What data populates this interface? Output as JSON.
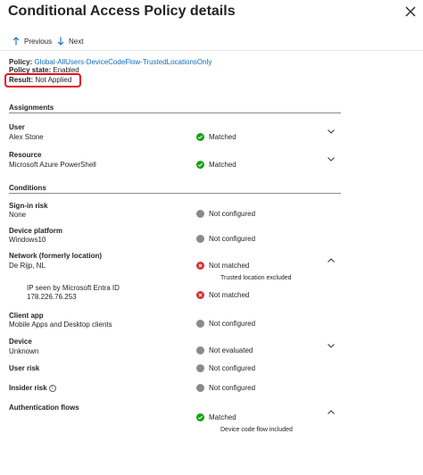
{
  "header": {
    "title": "Conditional Access Policy details",
    "close_icon": "close-icon"
  },
  "toolbar": {
    "previous_label": "Previous",
    "next_label": "Next"
  },
  "policy": {
    "policy_label": "Policy:",
    "policy_name": "Global-AllUsers-DeviceCodeFlow-TrustedLocationsOnly",
    "state_label": "Policy state:",
    "state_value": "Enabled",
    "result_label": "Result:",
    "result_value": "Not Applied"
  },
  "highlight_color": "#e8101e",
  "sections": {
    "assignments": "Assignments",
    "conditions": "Conditions"
  },
  "assignments": {
    "user": {
      "label": "User",
      "value": "Alex Stone",
      "status": "Matched"
    },
    "resource": {
      "label": "Resource",
      "value": "Microsoft Azure PowerShell",
      "status": "Matched"
    }
  },
  "conditions": {
    "sign_in_risk": {
      "label": "Sign-in risk",
      "value": "None",
      "status": "Not configured"
    },
    "device_platform": {
      "label": "Device platform",
      "value": "Windows10",
      "status": "Not configured"
    },
    "network": {
      "label": "Network (formerly location)",
      "value": "De Rijp, NL",
      "status": "Not matched",
      "note": "Trusted location excluded",
      "ip_seen_label": "IP seen by Microsoft Entra ID",
      "ip_value": "178.226.76.253",
      "ip_status": "Not matched"
    },
    "client_app": {
      "label": "Client app",
      "value": "Mobile Apps and Desktop clients",
      "status": "Not configured"
    },
    "device": {
      "label": "Device",
      "value": "Unknown",
      "status": "Not evaluated"
    },
    "user_risk": {
      "label": "User risk",
      "status": "Not configured"
    },
    "insider_risk": {
      "label": "Insider risk",
      "status": "Not configured"
    },
    "auth_flows": {
      "label": "Authentication flows",
      "status": "Matched",
      "note": "Device code flow included"
    }
  },
  "colors": {
    "matched": "#13a10e",
    "not_matched": "#d13438",
    "neutral": "#8a8a8a",
    "link": "#0f6cbd"
  }
}
